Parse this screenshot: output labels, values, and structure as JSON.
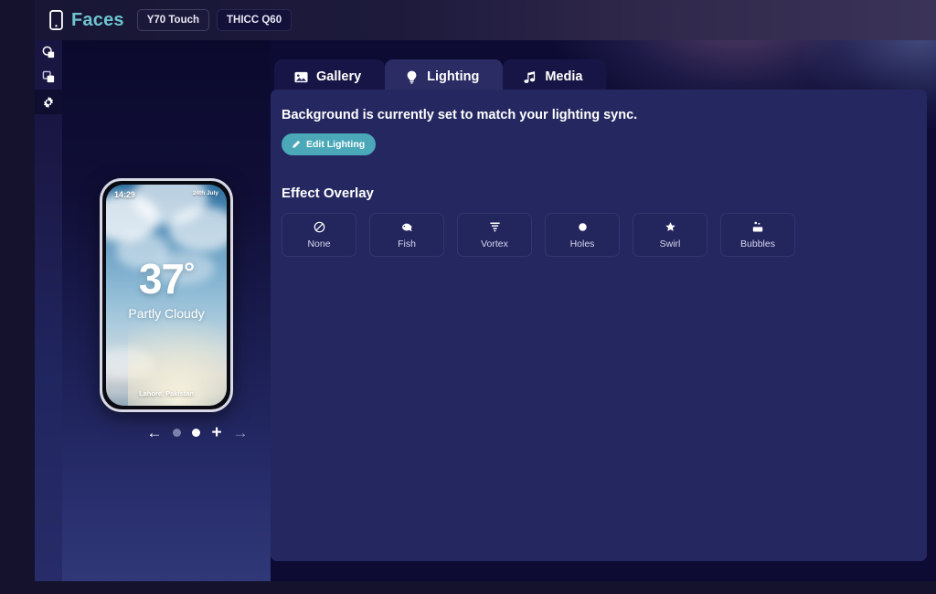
{
  "app": {
    "brand_name": "Faces",
    "brand_icon": "phone-icon",
    "device_tabs": [
      {
        "label": "Y70 Touch",
        "active": true
      },
      {
        "label": "THICC Q60",
        "active": false
      }
    ]
  },
  "rail": {
    "items": [
      {
        "name": "shape-circle-square-icon",
        "active": false
      },
      {
        "name": "layers-icon",
        "active": false
      },
      {
        "name": "gear-icon",
        "active": true
      }
    ]
  },
  "preview": {
    "phone_face": {
      "time": "14:29",
      "date": "24th July",
      "temperature": "37",
      "degree_symbol": "°",
      "condition": "Partly Cloudy",
      "location": "Lahore, Pakistan"
    },
    "carousel": {
      "prev_arrow": "←",
      "next_arrow": "→",
      "add": "+",
      "dots": [
        {
          "active": false
        },
        {
          "active": true
        }
      ]
    }
  },
  "main": {
    "tabs": [
      {
        "label": "Gallery",
        "icon": "image-icon",
        "active": false
      },
      {
        "label": "Lighting",
        "icon": "lightbulb-icon",
        "active": true
      },
      {
        "label": "Media",
        "icon": "music-note-icon",
        "active": false
      }
    ],
    "panel": {
      "note": "Background is currently set to match your lighting sync.",
      "edit_button": {
        "label": "Edit Lighting",
        "icon": "pencil-icon"
      },
      "section_title": "Effect Overlay",
      "effects": [
        {
          "label": "None",
          "icon": "ban-icon"
        },
        {
          "label": "Fish",
          "icon": "fish-icon"
        },
        {
          "label": "Vortex",
          "icon": "vortex-icon"
        },
        {
          "label": "Holes",
          "icon": "circle-icon"
        },
        {
          "label": "Swirl",
          "icon": "star-icon"
        },
        {
          "label": "Bubbles",
          "icon": "bubbles-icon"
        }
      ]
    }
  },
  "colors": {
    "brand_teal": "#6ec4cf",
    "accent_button": "#4aa8b8",
    "panel_bg": "#252860",
    "app_bg": "#0d0b33",
    "tab_active": "#2b2c63"
  }
}
